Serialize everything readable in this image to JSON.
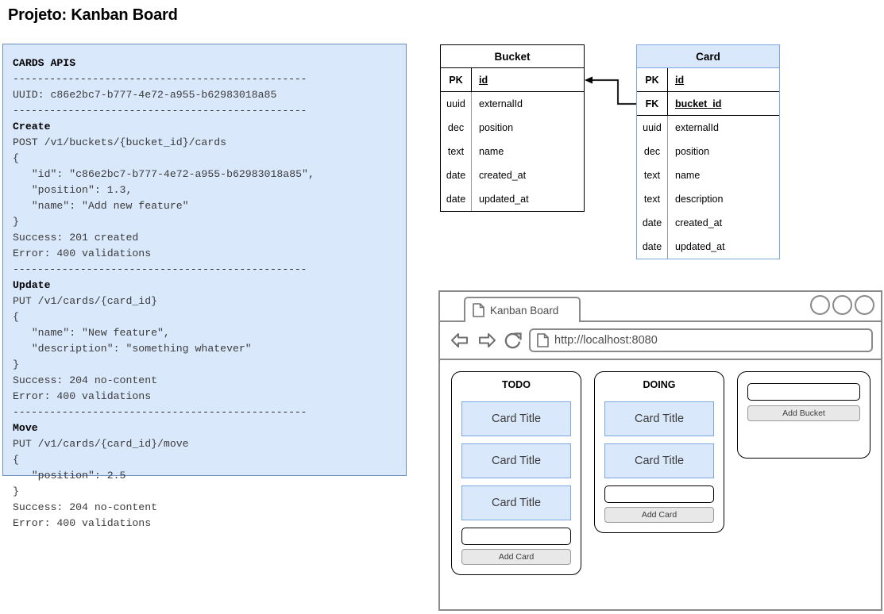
{
  "page_title": "Projeto: Kanban Board",
  "api_panel": {
    "lines": [
      {
        "text": "CARDS APIS",
        "style": "hdr"
      },
      {
        "text": "------------------------------------------------",
        "style": "rule"
      },
      {
        "text": "UUID: c86e2bc7-b777-4e72-a955-b62983018a85",
        "style": "body"
      },
      {
        "text": "------------------------------------------------",
        "style": "rule"
      },
      {
        "text": "Create",
        "style": "hdr"
      },
      {
        "text": "POST /v1/buckets/{bucket_id}/cards",
        "style": "body"
      },
      {
        "text": "{",
        "style": "body"
      },
      {
        "text": "   \"id\": \"c86e2bc7-b777-4e72-a955-b62983018a85\",",
        "style": "body"
      },
      {
        "text": "   \"position\": 1.3,",
        "style": "body"
      },
      {
        "text": "   \"name\": \"Add new feature\"",
        "style": "body"
      },
      {
        "text": "}",
        "style": "body"
      },
      {
        "text": "Success: 201 created",
        "style": "body"
      },
      {
        "text": "Error: 400 validations",
        "style": "body"
      },
      {
        "text": "------------------------------------------------",
        "style": "rule"
      },
      {
        "text": "Update",
        "style": "hdr"
      },
      {
        "text": "PUT /v1/cards/{card_id}",
        "style": "body"
      },
      {
        "text": "{",
        "style": "body"
      },
      {
        "text": "   \"name\": \"New feature\",",
        "style": "body"
      },
      {
        "text": "   \"description\": \"something whatever\"",
        "style": "body"
      },
      {
        "text": "}",
        "style": "body"
      },
      {
        "text": "Success: 204 no-content",
        "style": "body"
      },
      {
        "text": "Error: 400 validations",
        "style": "body"
      },
      {
        "text": "------------------------------------------------",
        "style": "rule"
      },
      {
        "text": "Move",
        "style": "hdr"
      },
      {
        "text": "PUT /v1/cards/{card_id}/move",
        "style": "body"
      },
      {
        "text": "{",
        "style": "body"
      },
      {
        "text": "   \"position\": 2.5",
        "style": "body"
      },
      {
        "text": "}",
        "style": "body"
      },
      {
        "text": "Success: 204 no-content",
        "style": "body"
      },
      {
        "text": "Error: 400 validations",
        "style": "body"
      }
    ]
  },
  "er_diagram": {
    "bucket": {
      "title": "Bucket",
      "rows": [
        {
          "type": "PK",
          "name": "id",
          "key": true
        },
        {
          "type": "uuid",
          "name": "externalId",
          "key": false
        },
        {
          "type": "dec",
          "name": "position",
          "key": false
        },
        {
          "type": "text",
          "name": "name",
          "key": false
        },
        {
          "type": "date",
          "name": "created_at",
          "key": false
        },
        {
          "type": "date",
          "name": "updated_at",
          "key": false
        }
      ]
    },
    "card": {
      "title": "Card",
      "rows": [
        {
          "type": "PK",
          "name": "id",
          "key": true
        },
        {
          "type": "FK",
          "name": "bucket_id",
          "key": true
        },
        {
          "type": "uuid",
          "name": "externalId",
          "key": false
        },
        {
          "type": "dec",
          "name": "position",
          "key": false
        },
        {
          "type": "text",
          "name": "name",
          "key": false
        },
        {
          "type": "text",
          "name": "description",
          "key": false
        },
        {
          "type": "date",
          "name": "created_at",
          "key": false
        },
        {
          "type": "date",
          "name": "updated_at",
          "key": false
        }
      ]
    }
  },
  "browser": {
    "tab_label": "Kanban Board",
    "url": "http://localhost:8080",
    "kanban": {
      "columns": [
        {
          "title": "TODO",
          "cards": [
            "Card Title",
            "Card Title",
            "Card Title"
          ],
          "input_value": "",
          "button_label": "Add Card"
        },
        {
          "title": "DOING",
          "cards": [
            "Card Title",
            "Card Title"
          ],
          "input_value": "",
          "button_label": "Add Card"
        }
      ],
      "add_bucket": {
        "input_value": "",
        "button_label": "Add Bucket"
      }
    }
  },
  "colors": {
    "accent_fill": "#dae8fc",
    "accent_border": "#6c8ebf",
    "card_border": "#7ea6e0",
    "chrome_gray": "#8a8a8a",
    "button_fill": "#e8e8e8"
  }
}
